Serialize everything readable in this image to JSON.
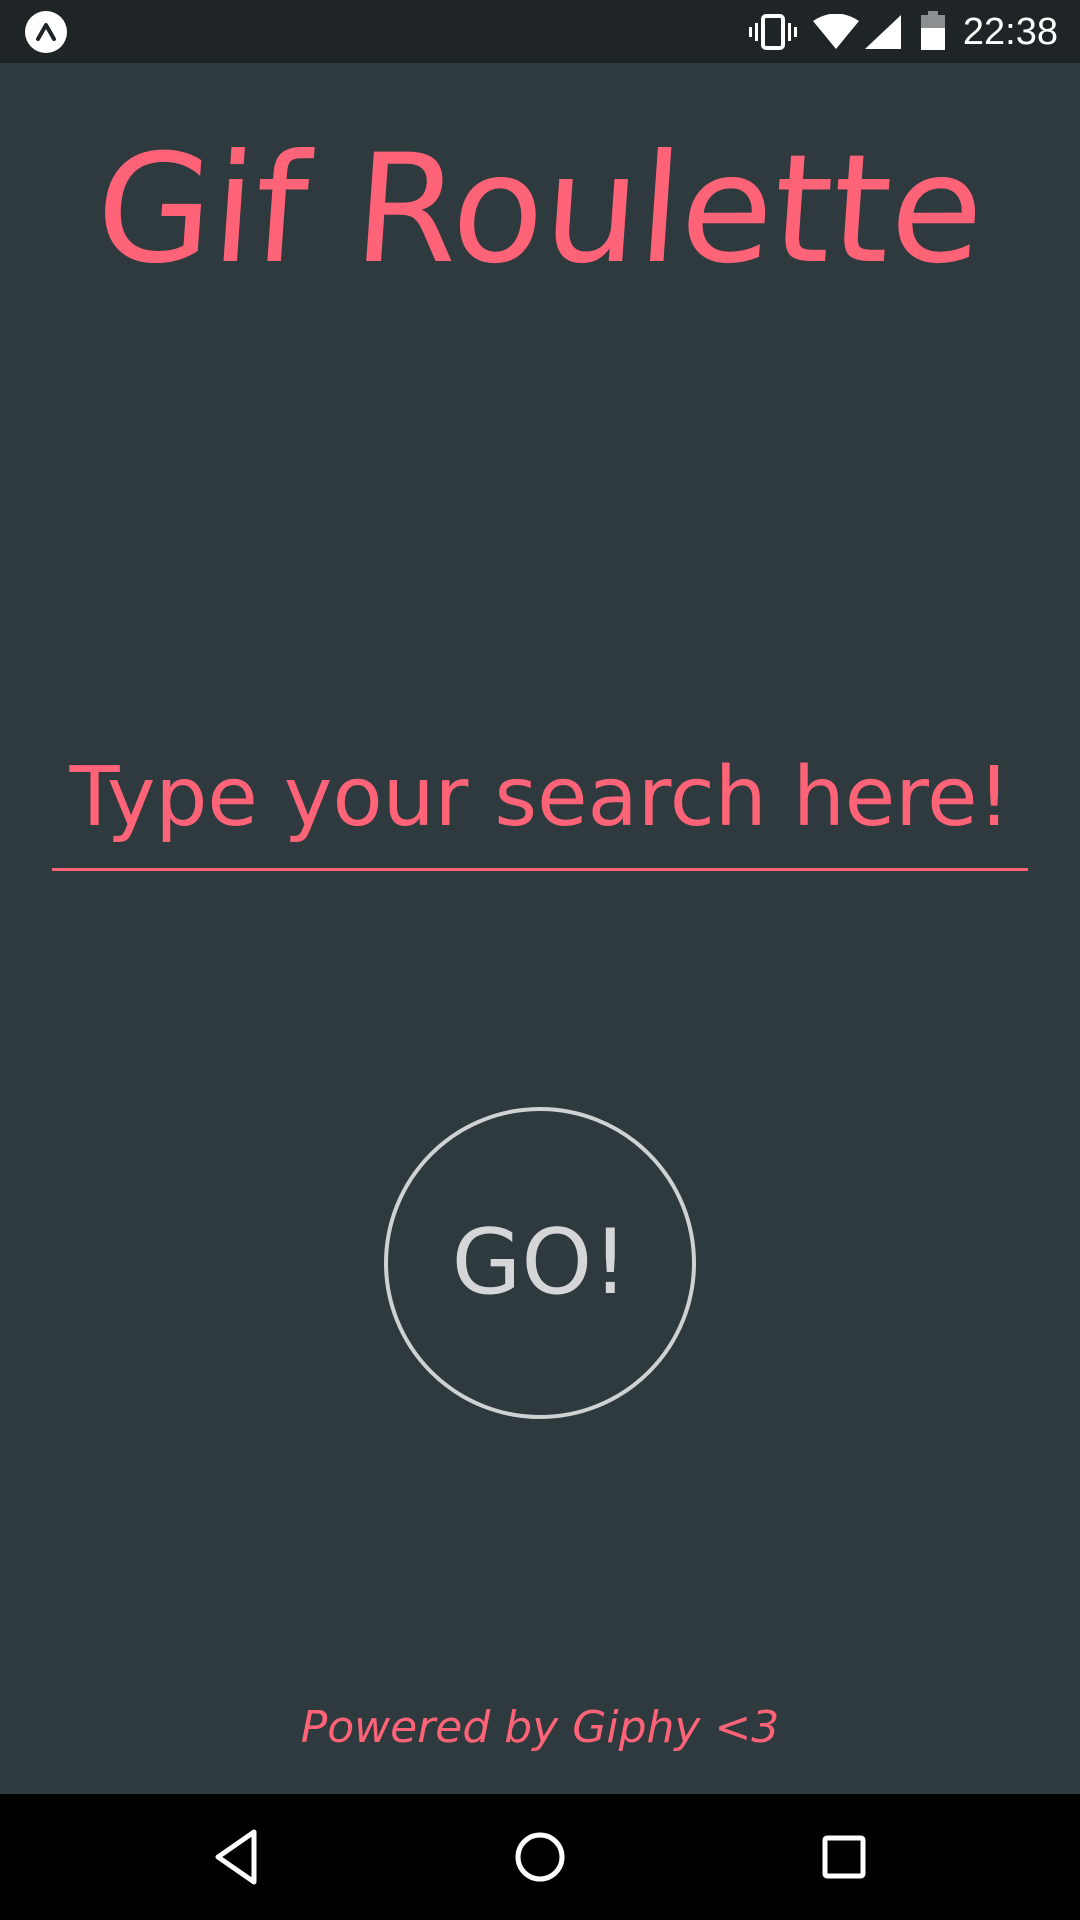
{
  "status_bar": {
    "time": "22:38",
    "icons": [
      "app-notification-icon",
      "vibrate-icon",
      "wifi-icon",
      "cell-signal-icon",
      "battery-icon"
    ]
  },
  "app": {
    "title": "Gif Roulette",
    "search": {
      "placeholder": "Type your search here!",
      "value": ""
    },
    "go_label": "GO!",
    "footer": "Powered by Giphy <3"
  },
  "nav_bar": {
    "buttons": [
      "back-icon",
      "home-icon",
      "recents-icon"
    ]
  },
  "colors": {
    "background": "#2f3a3e",
    "accent": "#ff6378",
    "button_outline": "#cfd2d3",
    "status_bar": "#1f2426",
    "nav_bar": "#000000"
  }
}
